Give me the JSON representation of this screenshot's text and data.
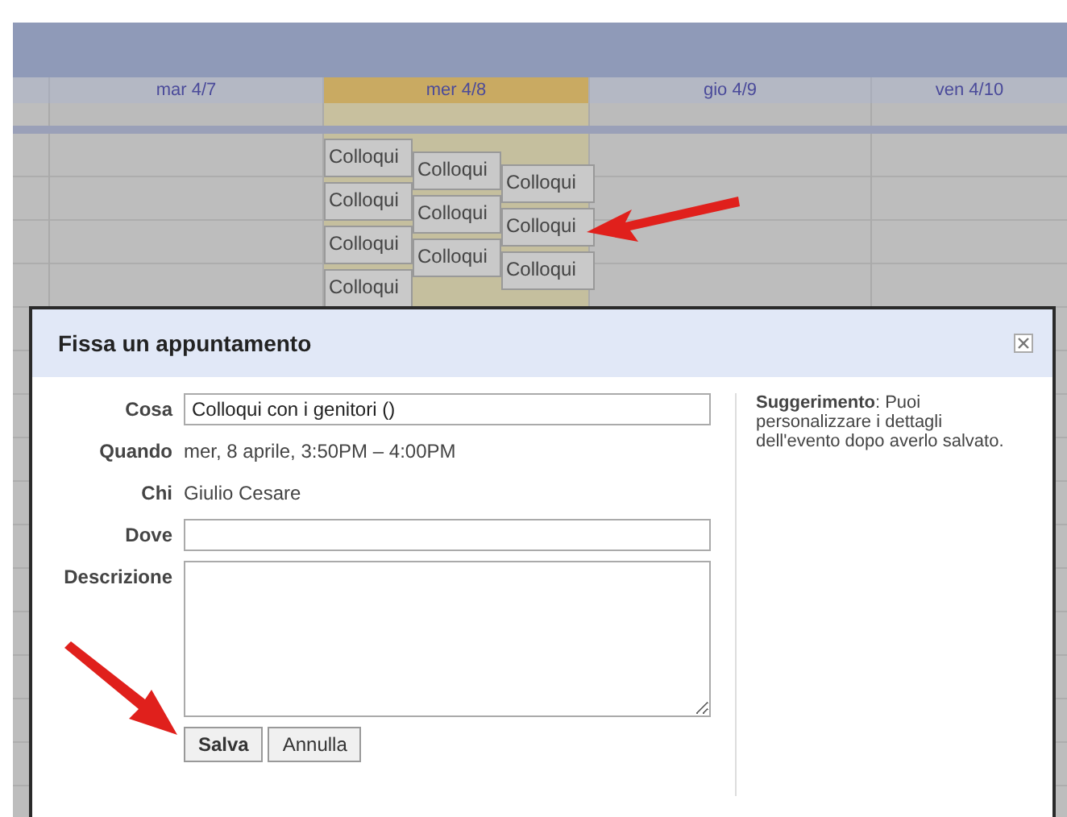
{
  "calendar": {
    "days": [
      {
        "label": "mar 4/7",
        "selected": false
      },
      {
        "label": "mer 4/8",
        "selected": true
      },
      {
        "label": "gio 4/9",
        "selected": false
      },
      {
        "label": "ven 4/10",
        "selected": false
      }
    ],
    "event_columns": [
      {
        "events": [
          "Colloqui",
          "Colloqui",
          "Colloqui",
          "Colloqui"
        ]
      },
      {
        "events": [
          "Colloqui",
          "Colloqui",
          "Colloqui"
        ]
      },
      {
        "events": [
          "Colloqui",
          "Colloqui",
          "Colloqui"
        ]
      }
    ]
  },
  "dialog": {
    "title": "Fissa un appuntamento",
    "fields": [
      {
        "label": "Cosa",
        "kind": "input",
        "value": "Colloqui con i genitori ()"
      },
      {
        "label": "Quando",
        "kind": "text",
        "value": "mer, 8 aprile, 3:50PM – 4:00PM"
      },
      {
        "label": "Chi",
        "kind": "text",
        "value": "Giulio Cesare"
      },
      {
        "label": "Dove",
        "kind": "input"
      },
      {
        "label": "Descrizione",
        "kind": "textarea"
      }
    ],
    "buttons": [
      {
        "label": "Salva",
        "primary": true
      },
      {
        "label": "Annulla",
        "primary": false
      }
    ],
    "hint": "**Suggerimento**: Puoi personalizzare i dettagli dell'evento dopo averlo salvato."
  }
}
